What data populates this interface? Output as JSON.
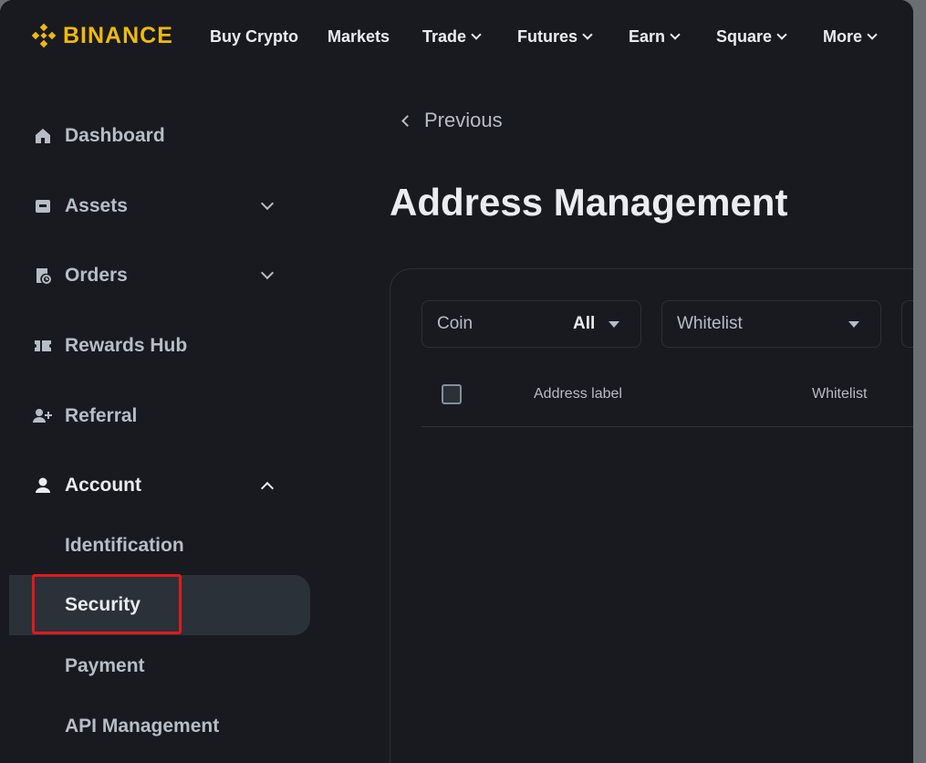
{
  "brand": {
    "name": "BINANCE",
    "color": "#f0b90b"
  },
  "topnav": {
    "items": [
      {
        "label": "Buy Crypto",
        "has_dropdown": false
      },
      {
        "label": "Markets",
        "has_dropdown": false
      },
      {
        "label": "Trade",
        "has_dropdown": true
      },
      {
        "label": "Futures",
        "has_dropdown": true
      },
      {
        "label": "Earn",
        "has_dropdown": true
      },
      {
        "label": "Square",
        "has_dropdown": true
      },
      {
        "label": "More",
        "has_dropdown": true
      }
    ]
  },
  "sidebar": {
    "items": [
      {
        "label": "Dashboard",
        "icon": "home-icon"
      },
      {
        "label": "Assets",
        "icon": "wallet-icon",
        "expandable": true,
        "expanded": false
      },
      {
        "label": "Orders",
        "icon": "orders-icon",
        "expandable": true,
        "expanded": false
      },
      {
        "label": "Rewards Hub",
        "icon": "ticket-icon"
      },
      {
        "label": "Referral",
        "icon": "add-user-icon"
      },
      {
        "label": "Account",
        "icon": "user-icon",
        "expandable": true,
        "expanded": true
      }
    ],
    "account_subitems": [
      {
        "label": "Identification",
        "active": false
      },
      {
        "label": "Security",
        "active": true,
        "highlighted": true
      },
      {
        "label": "Payment",
        "active": false
      },
      {
        "label": "API Management",
        "active": false
      }
    ]
  },
  "main": {
    "back_label": "Previous",
    "title": "Address Management",
    "filters": {
      "coin": {
        "label": "Coin",
        "value": "All"
      },
      "whitelist": {
        "label": "Whitelist",
        "value": ""
      }
    },
    "table": {
      "columns": [
        "Address label",
        "Whitelist"
      ]
    }
  },
  "colors": {
    "background": "#181a20",
    "surface_active": "#2b3139",
    "text_primary": "#eaecef",
    "text_secondary": "#b7bdc6",
    "highlight_outline": "#e0191c"
  }
}
